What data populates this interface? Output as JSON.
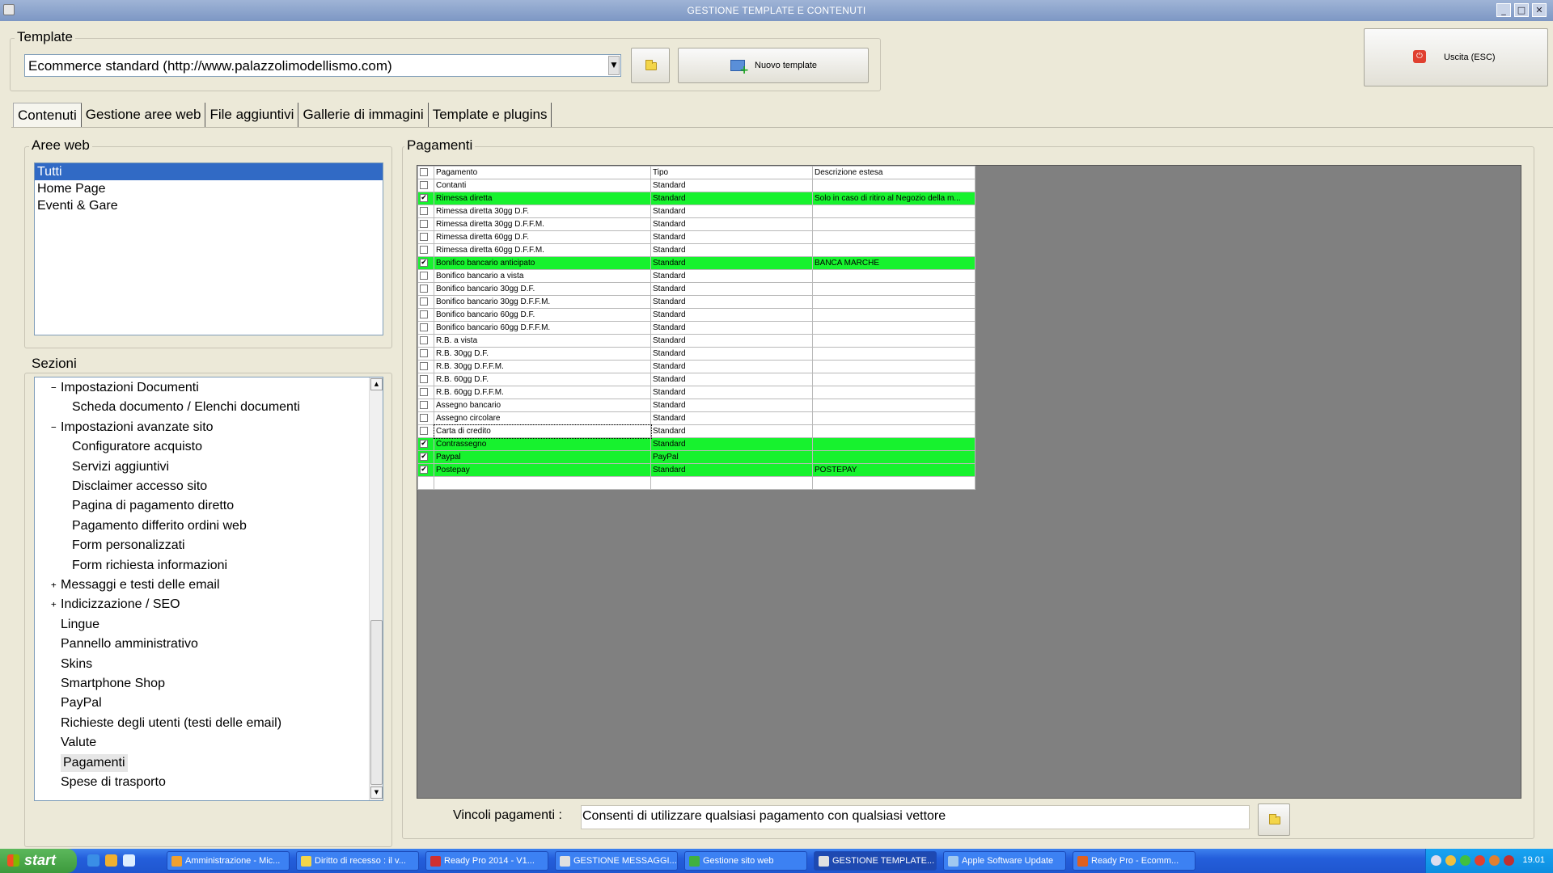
{
  "window": {
    "title": "GESTIONE TEMPLATE E CONTENUTI",
    "minimize": "_",
    "maximize": "□",
    "close": "✕"
  },
  "template": {
    "group_label": "Template",
    "selected": "Ecommerce standard (http://www.palazzolimodellismo.com)",
    "new_button": "Nuovo template"
  },
  "exit_button": "Uscita (ESC)",
  "tabs": [
    "Contenuti",
    "Gestione aree web",
    "File aggiuntivi",
    "Gallerie di immagini",
    "Template e plugins"
  ],
  "aree_web": {
    "label": "Aree web",
    "items": [
      "Tutti",
      "Home Page",
      "Eventi & Gare"
    ],
    "selected_index": 0
  },
  "sezioni": {
    "label": "Sezioni",
    "items": [
      {
        "text": "Impostazioni Documenti",
        "level": 1,
        "toggle": "−"
      },
      {
        "text": "Scheda documento / Elenchi documenti",
        "level": 2,
        "toggle": ""
      },
      {
        "text": "Impostazioni avanzate sito",
        "level": 1,
        "toggle": "−"
      },
      {
        "text": "Configuratore acquisto",
        "level": 2,
        "toggle": ""
      },
      {
        "text": "Servizi aggiuntivi",
        "level": 2,
        "toggle": ""
      },
      {
        "text": "Disclaimer accesso sito",
        "level": 2,
        "toggle": ""
      },
      {
        "text": "Pagina di pagamento diretto",
        "level": 2,
        "toggle": ""
      },
      {
        "text": "Pagamento differito ordini web",
        "level": 2,
        "toggle": ""
      },
      {
        "text": "Form personalizzati",
        "level": 2,
        "toggle": ""
      },
      {
        "text": "Form richiesta informazioni",
        "level": 2,
        "toggle": ""
      },
      {
        "text": "Messaggi e testi delle email",
        "level": 1,
        "toggle": "+"
      },
      {
        "text": "Indicizzazione / SEO",
        "level": 1,
        "toggle": "+"
      },
      {
        "text": "Lingue",
        "level": 1,
        "toggle": ""
      },
      {
        "text": "Pannello amministrativo",
        "level": 1,
        "toggle": ""
      },
      {
        "text": "Skins",
        "level": 1,
        "toggle": ""
      },
      {
        "text": "Smartphone Shop",
        "level": 1,
        "toggle": ""
      },
      {
        "text": "PayPal",
        "level": 1,
        "toggle": ""
      },
      {
        "text": "Richieste degli utenti (testi delle email)",
        "level": 1,
        "toggle": ""
      },
      {
        "text": "Valute",
        "level": 1,
        "toggle": ""
      },
      {
        "text": "Pagamenti",
        "level": 1,
        "toggle": "",
        "selected": true
      },
      {
        "text": "Spese di trasporto",
        "level": 1,
        "toggle": ""
      }
    ]
  },
  "pagamenti": {
    "label": "Pagamenti",
    "columns": [
      "Pagamento",
      "Tipo",
      "Descrizione estesa"
    ],
    "rows": [
      {
        "name": "Contanti",
        "tipo": "Standard",
        "desc": "",
        "checked": false
      },
      {
        "name": "Rimessa diretta",
        "tipo": "Standard",
        "desc": "Solo in caso di ritiro al Negozio della m...",
        "checked": true
      },
      {
        "name": "Rimessa diretta 30gg D.F.",
        "tipo": "Standard",
        "desc": "",
        "checked": false
      },
      {
        "name": "Rimessa diretta 30gg D.F.F.M.",
        "tipo": "Standard",
        "desc": "",
        "checked": false
      },
      {
        "name": "Rimessa diretta 60gg D.F.",
        "tipo": "Standard",
        "desc": "",
        "checked": false
      },
      {
        "name": "Rimessa diretta 60gg D.F.F.M.",
        "tipo": "Standard",
        "desc": "",
        "checked": false
      },
      {
        "name": "Bonifico bancario anticipato",
        "tipo": "Standard",
        "desc": "BANCA MARCHE",
        "checked": true
      },
      {
        "name": "Bonifico bancario a vista",
        "tipo": "Standard",
        "desc": "",
        "checked": false
      },
      {
        "name": "Bonifico bancario 30gg D.F.",
        "tipo": "Standard",
        "desc": "",
        "checked": false
      },
      {
        "name": "Bonifico bancario 30gg D.F.F.M.",
        "tipo": "Standard",
        "desc": "",
        "checked": false
      },
      {
        "name": "Bonifico bancario 60gg D.F.",
        "tipo": "Standard",
        "desc": "",
        "checked": false
      },
      {
        "name": "Bonifico bancario 60gg D.F.F.M.",
        "tipo": "Standard",
        "desc": "",
        "checked": false
      },
      {
        "name": "R.B. a vista",
        "tipo": "Standard",
        "desc": "",
        "checked": false
      },
      {
        "name": "R.B. 30gg D.F.",
        "tipo": "Standard",
        "desc": "",
        "checked": false
      },
      {
        "name": "R.B. 30gg D.F.F.M.",
        "tipo": "Standard",
        "desc": "",
        "checked": false
      },
      {
        "name": "R.B. 60gg D.F.",
        "tipo": "Standard",
        "desc": "",
        "checked": false
      },
      {
        "name": "R.B. 60gg D.F.F.M.",
        "tipo": "Standard",
        "desc": "",
        "checked": false
      },
      {
        "name": "Assegno bancario",
        "tipo": "Standard",
        "desc": "",
        "checked": false
      },
      {
        "name": "Assegno circolare",
        "tipo": "Standard",
        "desc": "",
        "checked": false
      },
      {
        "name": "Carta di credito",
        "tipo": "Standard",
        "desc": "",
        "checked": false,
        "focused": true
      },
      {
        "name": "Contrassegno",
        "tipo": "Standard",
        "desc": "",
        "checked": true
      },
      {
        "name": "Paypal",
        "tipo": "PayPal",
        "desc": "",
        "checked": true
      },
      {
        "name": "Postepay",
        "tipo": "Standard",
        "desc": "POSTEPAY",
        "checked": true
      }
    ]
  },
  "vincoli": {
    "label": "Vincoli pagamenti :",
    "value": "Consenti di utilizzare qualsiasi pagamento con qualsiasi vettore"
  },
  "taskbar": {
    "start": "start",
    "tasks": [
      {
        "label": "Amministrazione - Mic...",
        "active": false,
        "icon_color": "#f0a030"
      },
      {
        "label": "Diritto di recesso : il v...",
        "active": false,
        "icon_color": "#f3d54a"
      },
      {
        "label": "Ready Pro 2014 - V1...",
        "active": false,
        "icon_color": "#d03030"
      },
      {
        "label": "GESTIONE MESSAGGI...",
        "active": false,
        "icon_color": "#e0e0e0"
      },
      {
        "label": "Gestione sito web",
        "active": false,
        "icon_color": "#40b040"
      },
      {
        "label": "GESTIONE TEMPLATE...",
        "active": true,
        "icon_color": "#e0e0e0"
      },
      {
        "label": "Apple Software Update",
        "active": false,
        "icon_color": "#a0c8f0"
      },
      {
        "label": "Ready Pro - Ecomm...",
        "active": false,
        "icon_color": "#e06020"
      }
    ],
    "clock": "19.01"
  }
}
